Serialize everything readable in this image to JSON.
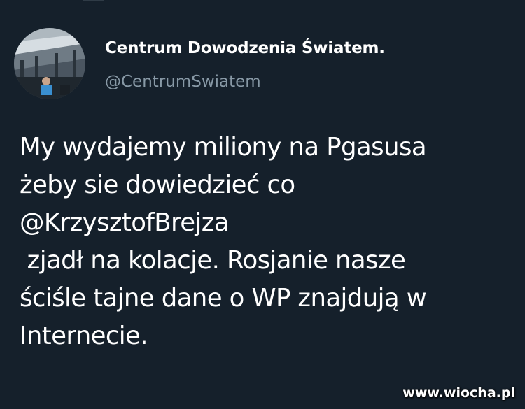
{
  "tweet": {
    "display_name": "Centrum Dowodzenia Światem.",
    "handle": "@CentrumSwiatem",
    "text_lines": [
      "My wydajemy miliony na Pgasusa",
      "żeby sie dowiedzieć co",
      "@KrzysztofBrejza",
      " zjadł na kolacje. Rosjanie nasze",
      "ściśle tajne dane o WP znajdują w",
      "Internecie."
    ]
  },
  "watermark": {
    "text": "www.wiocha.pl"
  },
  "colors": {
    "background": "#15202b",
    "text": "#ffffff",
    "handle": "#8899a6"
  }
}
